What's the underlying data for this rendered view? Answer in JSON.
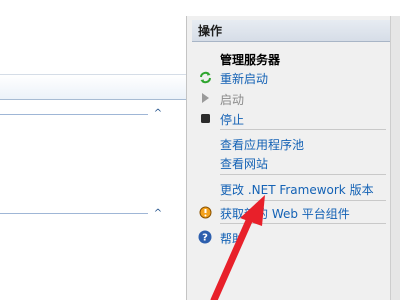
{
  "actions": {
    "header": "操作",
    "server_heading": "管理服务器",
    "restart": "重新启动",
    "start": "启动",
    "stop": "停止",
    "view_app_pools": "查看应用程序池",
    "view_sites": "查看网站",
    "change_net": "更改 .NET Framework 版本",
    "get_web": "获取新的 Web 平台组件",
    "help": "帮助"
  },
  "icons": {
    "restart": "restart-icon",
    "start": "play-icon",
    "stop": "stop-icon",
    "web_platform": "web-platform-icon",
    "help": "help-icon",
    "collapse": "chevron-up-icon"
  },
  "colors": {
    "link": "#1462b5",
    "annotation_arrow": "#e8202a"
  }
}
